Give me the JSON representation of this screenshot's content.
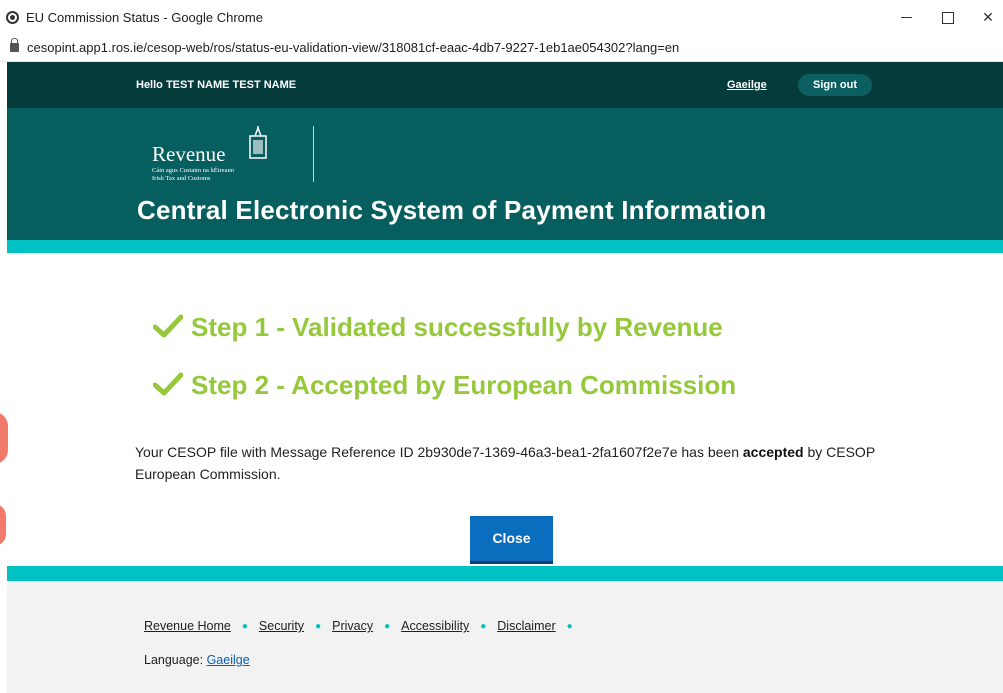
{
  "browser": {
    "window_title": "EU Commission Status - Google Chrome",
    "url": "cesopint.app1.ros.ie/cesop-web/ros/status-eu-validation-view/318081cf-eaac-4db7-9227-1eb1ae054302?lang=en"
  },
  "userbar": {
    "greeting": "Hello TEST NAME TEST NAME",
    "language_link": "Gaeilge",
    "signout_label": "Sign out"
  },
  "banner": {
    "logo_text": "Revenue",
    "logo_sub1": "Cáin agus Custaim na hÉireann",
    "logo_sub2": "Irish Tax and Customs",
    "system_title": "Central Electronic System of Payment Information"
  },
  "main": {
    "step1": "Step 1 - Validated successfully by Revenue",
    "step2": "Step 2 - Accepted by European Commission",
    "message_pre": "Your CESOP file with Message Reference ID 2b930de7-1369-46a3-bea1-2fa1607f2e7e has been ",
    "message_bold": "accepted",
    "message_post": " by CESOP European Commission.",
    "close_label": "Close"
  },
  "footer": {
    "links": [
      "Revenue Home",
      "Security",
      "Privacy",
      "Accessibility",
      "Disclaimer"
    ],
    "language_label": "Language: ",
    "language_link": "Gaeilge"
  },
  "colors": {
    "dark_teal": "#063b3c",
    "banner_teal": "#075e5f",
    "accent_teal": "#00c2c3",
    "success_green": "#96c83c",
    "button_blue": "#0b6dbe"
  }
}
